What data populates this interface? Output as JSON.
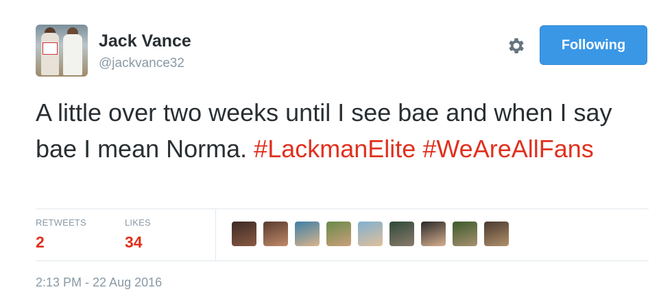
{
  "user": {
    "name": "Jack Vance",
    "handle": "@jackvance32"
  },
  "actions": {
    "follow_label": "Following",
    "settings_icon": "gear-icon"
  },
  "tweet": {
    "text_line": "A little over two weeks until I see bae and when I say bae I mean Norma.",
    "hashtags": [
      "#LackmanElite",
      "#WeAreAllFans"
    ]
  },
  "stats": {
    "retweets_label": "RETWEETS",
    "retweets_count": "2",
    "likes_label": "LIKES",
    "likes_count": "34"
  },
  "likers": [
    {
      "colors": [
        "#3b2a24",
        "#8a5a44"
      ]
    },
    {
      "colors": [
        "#5a3b2e",
        "#c08a6a"
      ]
    },
    {
      "colors": [
        "#3d7fa8",
        "#d9b48a"
      ]
    },
    {
      "colors": [
        "#6a8a4a",
        "#caa07a"
      ]
    },
    {
      "colors": [
        "#7fb0d0",
        "#e0c09a"
      ]
    },
    {
      "colors": [
        "#2e4a3a",
        "#8a7a6a"
      ]
    },
    {
      "colors": [
        "#2a2a2a",
        "#d8b090"
      ]
    },
    {
      "colors": [
        "#3a5a2a",
        "#a89070"
      ]
    },
    {
      "colors": [
        "#4a3a30",
        "#b0906a"
      ]
    }
  ],
  "timestamp": "2:13 PM - 22 Aug 2016",
  "colors": {
    "hashtag": "#e0301e",
    "follow_button": "#3a97e6",
    "stat_value": "#e0301e",
    "muted": "#8899a6"
  }
}
